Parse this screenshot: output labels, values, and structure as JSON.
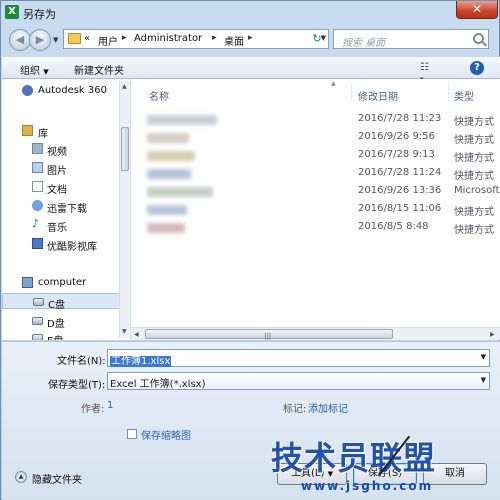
{
  "window": {
    "title": "另存为",
    "app_icon": "X"
  },
  "address": {
    "segments": [
      "用户",
      "Administrator",
      "桌面"
    ],
    "prefix": "«"
  },
  "search": {
    "placeholder": "搜索 桌面"
  },
  "toolbar": {
    "organize": "组织",
    "new_folder": "新建文件夹"
  },
  "nav": {
    "items": [
      {
        "label": "Autodesk 360",
        "icon": "autodesk-icon"
      },
      {
        "label": "库",
        "icon": "library-icon"
      },
      {
        "label": "视频",
        "icon": "video-icon"
      },
      {
        "label": "图片",
        "icon": "picture-icon"
      },
      {
        "label": "文档",
        "icon": "document-icon"
      },
      {
        "label": "迅雷下载",
        "icon": "download-icon"
      },
      {
        "label": "音乐",
        "icon": "music-icon"
      },
      {
        "label": "优酷影视库",
        "icon": "youku-icon"
      },
      {
        "label": "computer",
        "icon": "computer-icon"
      },
      {
        "label": "C盘",
        "icon": "drive-icon"
      },
      {
        "label": "D盘",
        "icon": "drive-icon"
      },
      {
        "label": "E盘",
        "icon": "drive-icon"
      }
    ]
  },
  "files": {
    "columns": {
      "name": "名称",
      "date": "修改日期",
      "type": "类型"
    },
    "rows": [
      {
        "date": "2016/7/28 11:23",
        "type": "快捷方式"
      },
      {
        "date": "2016/9/26 9:56",
        "type": "快捷方式"
      },
      {
        "date": "2016/7/28 9:13",
        "type": "快捷方式"
      },
      {
        "date": "2016/7/28 11:24",
        "type": "快捷方式"
      },
      {
        "date": "2016/9/26 13:36",
        "type": "Microsoft"
      },
      {
        "date": "2016/8/15 11:06",
        "type": "快捷方式"
      },
      {
        "date": "2016/8/5 8:48",
        "type": "快捷方式"
      }
    ]
  },
  "form": {
    "filename_label": "文件名(N):",
    "filename_value": "工作簿1.xlsx",
    "savetype_label": "保存类型(T):",
    "savetype_value": "Excel 工作簿(*.xlsx)",
    "author_label": "作者:",
    "author_value": "1",
    "tags_label": "标记:",
    "tags_value": "添加标记",
    "thumbnail_label": "保存缩略图"
  },
  "footer": {
    "hide_folders": "隐藏文件夹",
    "tools": "工具(L)",
    "save": "保存(S)",
    "cancel": "取消"
  },
  "watermark": {
    "title": "技术员联盟",
    "url": "www.jsgho.com"
  },
  "colors": {
    "accent": "#3b79d0",
    "link": "#2a5fb2",
    "watermark": "#1b4aa8"
  }
}
